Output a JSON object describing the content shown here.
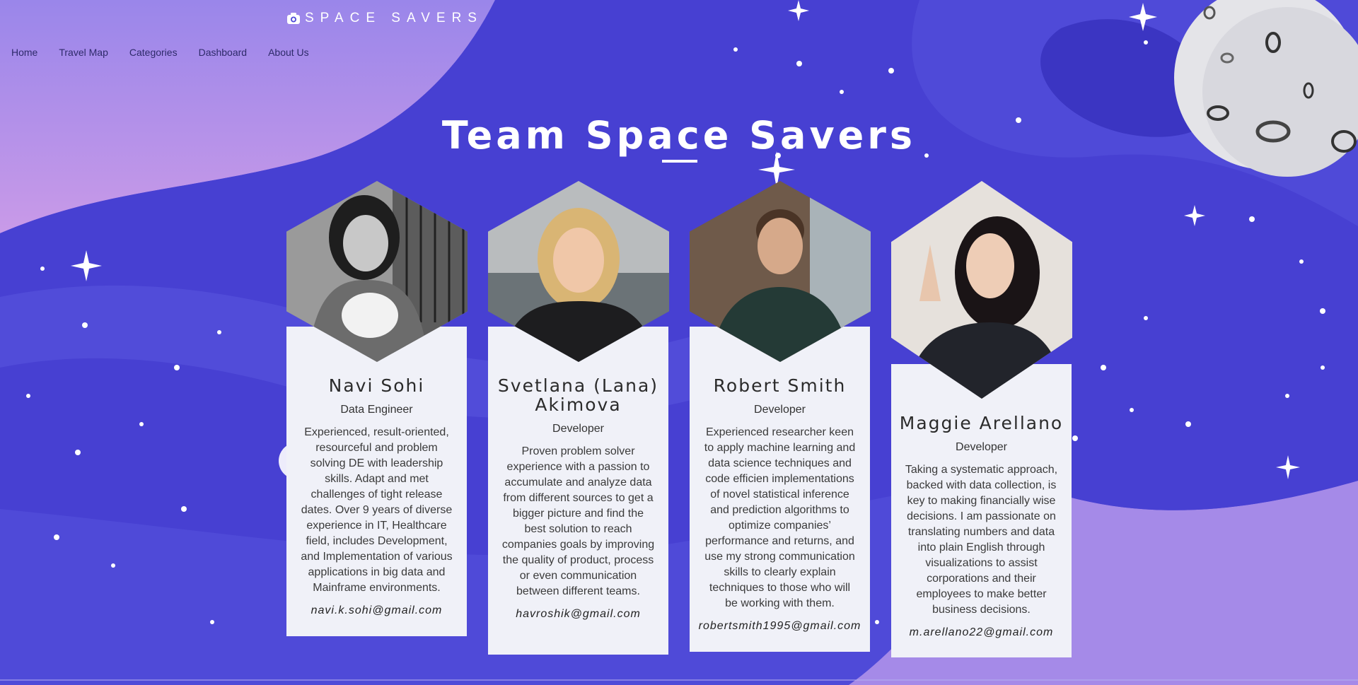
{
  "brand": {
    "name": "SPACE SAVERS",
    "icon": "camera-icon"
  },
  "nav": {
    "items": [
      "Home",
      "Travel Map",
      "Categories",
      "Dashboard",
      "About Us"
    ]
  },
  "page": {
    "title": "Team Space Savers"
  },
  "colors": {
    "background": "#4a45d6",
    "accent": "#a98be8",
    "card": "#f0f1f8"
  },
  "team": [
    {
      "name": "Navi Sohi",
      "role": "Data Engineer",
      "description": "Experienced, result-oriented, resourceful and problem solving DE with leadership skills. Adapt and met challenges of tight release dates. Over 9 years of diverse experience in IT, Healthcare field, includes Development, and Implementation of various applications in big data and Mainframe environments.",
      "email": "navi.k.sohi@gmail.com"
    },
    {
      "name": "Svetlana (Lana) Akimova",
      "role": "Developer",
      "description": "Proven problem solver experience with a passion to accumulate and analyze data from different sources to get a bigger picture and find the best solution to reach companies goals by improving the quality of product, process or even communication between different teams.",
      "email": "havroshik@gmail.com"
    },
    {
      "name": "Robert Smith",
      "role": "Developer",
      "description": "Experienced researcher keen to apply machine learning and data science techniques and code efficien implementations of novel statistical inference and prediction algorithms to optimize companies’ performance and returns, and use my strong communication skills to clearly explain techniques to those who will be working with them.",
      "email": "robertsmith1995@gmail.com"
    },
    {
      "name": "Maggie Arellano",
      "role": "Developer",
      "description": "Taking a systematic approach, backed with data collection, is key to making financially wise decisions. I am passionate on translating numbers and data into plain English through visualizations to assist corporations and their employees to make better business decisions.",
      "email": "m.arellano22@gmail.com"
    }
  ]
}
